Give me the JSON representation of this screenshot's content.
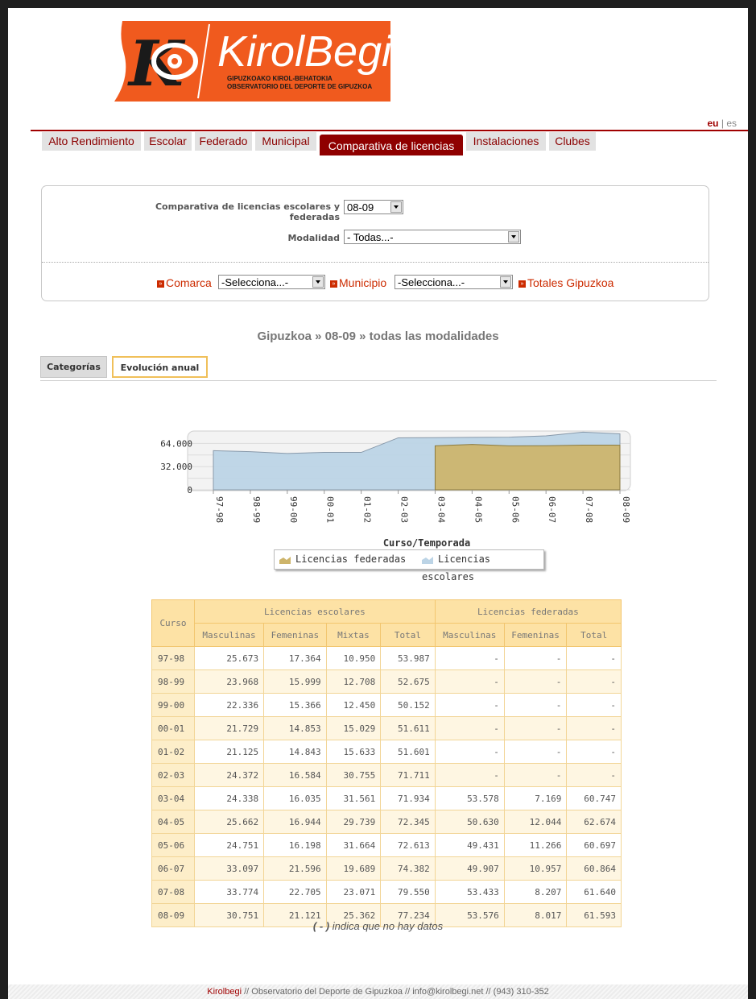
{
  "logo": {
    "name": "KirolBegi",
    "sub1": "GIPUZKOAKO KIROL-BEHATOKIA",
    "sub2": "OBSERVATORIO DEL DEPORTE DE GIPUZKOA",
    "brand_color": "#f05a1e"
  },
  "lang": {
    "eu": "eu",
    "sep": "|",
    "es": "es"
  },
  "nav": [
    "Alto Rendimiento",
    "Escolar",
    "Federado",
    "Municipal",
    "Comparativa de licencias",
    "Instalaciones",
    "Clubes"
  ],
  "filters": {
    "comparativa_label_1": "Comparativa de licencias escolares y",
    "comparativa_label_2": "federadas",
    "comparativa_value": "08-09",
    "modalidad_label": "Modalidad",
    "modalidad_value": "- Todas...-",
    "comarca_label": "Comarca",
    "comarca_value": "-Selecciona...-",
    "municipio_label": "Municipio",
    "municipio_value": "-Selecciona...-",
    "totales_label": "Totales Gipuzkoa"
  },
  "subtitle": "Gipuzkoa » 08-09 » todas las modalidades",
  "subtabs": [
    "Categorías",
    "Evolución anual"
  ],
  "chart_data": {
    "type": "area",
    "x": [
      "97-98",
      "98-99",
      "99-00",
      "00-01",
      "01-02",
      "02-03",
      "03-04",
      "04-05",
      "05-06",
      "06-07",
      "07-08",
      "08-09"
    ],
    "series": [
      {
        "name": "Licencias escolares",
        "values": [
          53987,
          52675,
          50152,
          51611,
          51601,
          71711,
          71934,
          72345,
          72613,
          74382,
          79550,
          77234
        ],
        "color": "#bcd4e6"
      },
      {
        "name": "Licencias federadas",
        "values": [
          null,
          null,
          null,
          null,
          null,
          null,
          60747,
          62674,
          60697,
          60864,
          61640,
          61593
        ],
        "color": "#cdb46a"
      }
    ],
    "yticks": [
      "0",
      "32.000",
      "64.000"
    ],
    "ylim": [
      0,
      80000
    ],
    "xlabel": "Curso/Temporada",
    "ylabel": "",
    "legend": [
      "Licencias federadas",
      "Licencias escolares"
    ]
  },
  "table": {
    "curso_header": "Curso",
    "group_escolares": "Licencias escolares",
    "group_federadas": "Licencias federadas",
    "sub_escolares": [
      "Masculinas",
      "Femeninas",
      "Mixtas",
      "Total"
    ],
    "sub_federadas": [
      "Masculinas",
      "Femeninas",
      "Total"
    ],
    "rows": [
      [
        "97-98",
        "25.673",
        "17.364",
        "10.950",
        "53.987",
        "-",
        "-",
        "-"
      ],
      [
        "98-99",
        "23.968",
        "15.999",
        "12.708",
        "52.675",
        "-",
        "-",
        "-"
      ],
      [
        "99-00",
        "22.336",
        "15.366",
        "12.450",
        "50.152",
        "-",
        "-",
        "-"
      ],
      [
        "00-01",
        "21.729",
        "14.853",
        "15.029",
        "51.611",
        "-",
        "-",
        "-"
      ],
      [
        "01-02",
        "21.125",
        "14.843",
        "15.633",
        "51.601",
        "-",
        "-",
        "-"
      ],
      [
        "02-03",
        "24.372",
        "16.584",
        "30.755",
        "71.711",
        "-",
        "-",
        "-"
      ],
      [
        "03-04",
        "24.338",
        "16.035",
        "31.561",
        "71.934",
        "53.578",
        "7.169",
        "60.747"
      ],
      [
        "04-05",
        "25.662",
        "16.944",
        "29.739",
        "72.345",
        "50.630",
        "12.044",
        "62.674"
      ],
      [
        "05-06",
        "24.751",
        "16.198",
        "31.664",
        "72.613",
        "49.431",
        "11.266",
        "60.697"
      ],
      [
        "06-07",
        "33.097",
        "21.596",
        "19.689",
        "74.382",
        "49.907",
        "10.957",
        "60.864"
      ],
      [
        "07-08",
        "33.774",
        "22.705",
        "23.071",
        "79.550",
        "53.433",
        "8.207",
        "61.640"
      ],
      [
        "08-09",
        "30.751",
        "21.121",
        "25.362",
        "77.234",
        "53.576",
        "8.017",
        "61.593"
      ]
    ]
  },
  "note": {
    "dash": "( - )",
    "text": " indica que no hay datos"
  },
  "footer": {
    "brand": "Kirolbegi",
    "text": " // Observatorio del Deporte de Gipuzkoa // info@kirolbegi.net // (943) 310-352"
  }
}
